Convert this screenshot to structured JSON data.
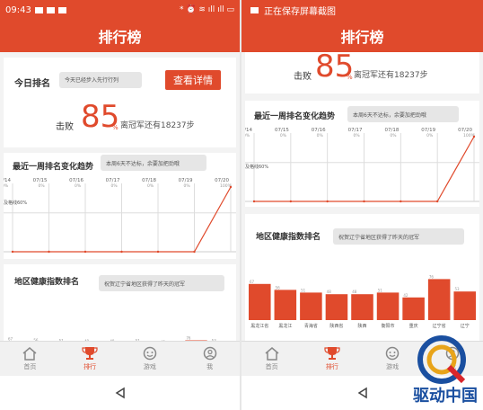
{
  "left": {
    "status": {
      "time": "09:43",
      "icons": "* ⏰ ≋ ıll ıll ▭"
    },
    "title": "排行榜",
    "today": {
      "label": "今日排名",
      "placeholder": "今天已经步入先行行列",
      "button": "查看详情"
    },
    "score": {
      "prefix": "击败",
      "value": "85",
      "unit": "%",
      "suffix": "离冠军还有18237步"
    },
    "trend": {
      "label": "最近一周排名变化趋势",
      "note": "本周6天不达标，余要加把劲哦",
      "pass_label": "及格线60%"
    },
    "region": {
      "label": "地区健康指数排名",
      "note": "祝贺辽宁省地区获得了昨天的冠军"
    },
    "tabs": [
      "首页",
      "排行",
      "游戏",
      "我"
    ]
  },
  "right": {
    "status": {
      "text": "正在保存屏幕截图"
    },
    "title": "排行榜",
    "score": {
      "prefix": "击败",
      "value": "85",
      "unit": "%",
      "suffix": "离冠军还有18237步"
    },
    "trend": {
      "label": "最近一周排名变化趋势",
      "note": "本周6天不达标，余要加把劲哦",
      "pass_label": "及格线60%"
    },
    "region": {
      "label": "地区健康指数排名",
      "note": "祝贺辽宁省地区获得了昨天的冠军"
    },
    "tabs": [
      "首页",
      "排行",
      "游戏",
      "我"
    ]
  },
  "watermark": "驱动中国",
  "chart_data": [
    {
      "type": "line",
      "title": "最近一周排名变化趋势",
      "x": [
        "07/14",
        "07/15",
        "07/16",
        "07/17",
        "07/18",
        "07/19",
        "07/20"
      ],
      "series": [
        {
          "values": [
            0,
            0,
            0,
            0,
            0,
            0,
            100
          ]
        }
      ],
      "point_labels": [
        "0%",
        "0%",
        "0%",
        "0%",
        "0%",
        "0%",
        "100%"
      ],
      "ylim": [
        0,
        100
      ],
      "reference_line": {
        "label": "及格线60%",
        "value": 60
      }
    },
    {
      "type": "bar",
      "title": "地区健康指数排名",
      "categories": [
        "黑龙江省",
        "黑龙江",
        "青海省",
        "陕西省",
        "陕西",
        "衡阳市",
        "重庆",
        "辽宁省",
        "辽宁"
      ],
      "values": [
        67,
        56,
        51,
        48,
        48,
        51,
        42,
        76,
        53
      ]
    }
  ],
  "colors": {
    "accent": "#e04a2c",
    "bar": "#e04a2c"
  }
}
